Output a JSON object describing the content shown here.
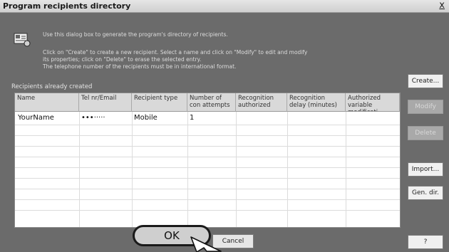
{
  "window": {
    "title": "Program recipients directory",
    "close_label": "x"
  },
  "intro": {
    "line1": "Use this dialog box to generate the program's directory of recipients.",
    "line2": "Click on \"Create\" to create a new recipient. Select a name and click on \"Modify\" to edit and modify",
    "line3": "its properties; click on \"Delete\" to erase the selected entry.",
    "line4": "The telephone number of the recipients must be in international format."
  },
  "section": {
    "label": "Recipients already created"
  },
  "table": {
    "headers": [
      "Name",
      "Tel nr/Email",
      "Recipient type",
      "Number of con attempts",
      "Recognition authorized",
      "Recognition delay (minutes)",
      "Authorized variable modificati"
    ],
    "rows": [
      [
        "YourName",
        "•••·····",
        "Mobile",
        "1",
        "",
        "",
        ""
      ]
    ]
  },
  "buttons": {
    "create": "Create...",
    "modify": "Modify",
    "delete": "Delete",
    "import": "Import...",
    "gen_dir": "Gen. dir.",
    "help": "?",
    "ok": "OK",
    "cancel": "Cancel"
  },
  "icons": {
    "dialog_icon": "directory-icon",
    "pointer": "mouse-pointer-icon"
  }
}
